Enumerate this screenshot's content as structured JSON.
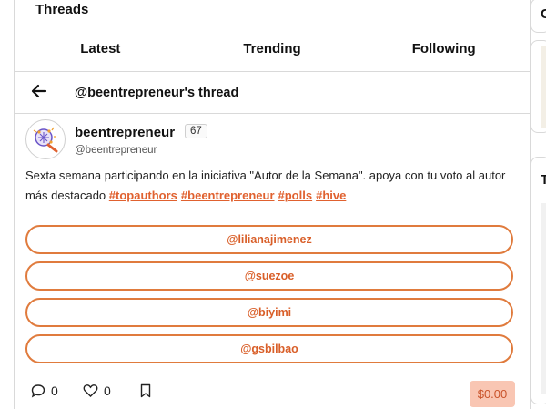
{
  "header": {
    "title": "Threads"
  },
  "tabs": [
    {
      "label": "Latest"
    },
    {
      "label": "Trending"
    },
    {
      "label": "Following"
    }
  ],
  "thread": {
    "back_icon": "arrow-left-icon",
    "title": "@beentrepreneur's thread"
  },
  "post": {
    "author": "beentrepreneur",
    "reputation": "67",
    "handle": "@beentrepreneur",
    "body": "Sexta semana participando en la iniciativa \"Autor de la Semana\". apoya con tu voto al autor más destacado",
    "tags": [
      "#topauthors",
      "#beentrepreneur",
      "#polls",
      "#hive"
    ],
    "poll_options": [
      "@lilianajimenez",
      "@suezoe",
      "@biyimi",
      "@gsbilbao"
    ],
    "comments": "0",
    "likes": "0",
    "payout": "$0.00"
  },
  "sidebar": {
    "top_letter": "C",
    "mid_letter": "T"
  },
  "colors": {
    "accent": "#e0612f",
    "payout_bg": "#f9c6b3",
    "border": "#d9d9d9"
  }
}
